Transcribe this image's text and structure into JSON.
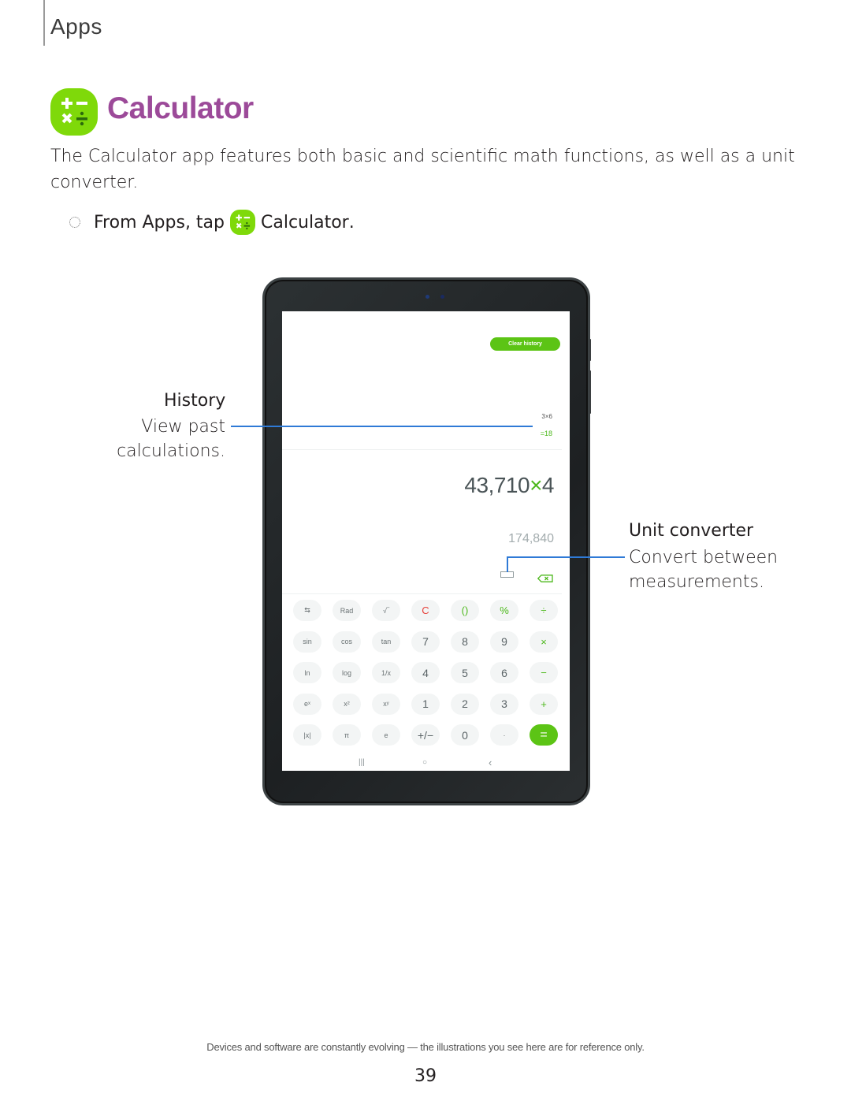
{
  "header": {
    "section": "Apps"
  },
  "title": {
    "text": "Calculator",
    "color": "#9c4a99",
    "icon": "calculator-app-icon",
    "icon_color": "#7fd90a"
  },
  "intro": "The Calculator app features both basic and scientific math functions, as well as a unit converter.",
  "step": {
    "prefix": "From Apps, tap",
    "app_name": "Calculator",
    "suffix": "."
  },
  "device_screen": {
    "clear_history_label": "Clear history",
    "history": {
      "expression": "3×6",
      "result": "=18"
    },
    "input": {
      "number": "43,710",
      "operator": "×",
      "operand": "4"
    },
    "preview_result": "174,840",
    "icons": {
      "unit_converter": "ruler-icon",
      "backspace": "backspace-icon"
    },
    "keypad": [
      [
        {
          "label": "⇆",
          "kind": "fn",
          "name": "switch-icon"
        },
        {
          "label": "Rad",
          "kind": "fn"
        },
        {
          "label": "√‾",
          "kind": "fn"
        },
        {
          "label": "C",
          "kind": "red"
        },
        {
          "label": "()",
          "kind": "green"
        },
        {
          "label": "%",
          "kind": "green"
        },
        {
          "label": "÷",
          "kind": "green"
        }
      ],
      [
        {
          "label": "sin",
          "kind": "fn"
        },
        {
          "label": "cos",
          "kind": "fn"
        },
        {
          "label": "tan",
          "kind": "fn"
        },
        {
          "label": "7",
          "kind": "num"
        },
        {
          "label": "8",
          "kind": "num"
        },
        {
          "label": "9",
          "kind": "num"
        },
        {
          "label": "×",
          "kind": "green"
        }
      ],
      [
        {
          "label": "ln",
          "kind": "fn"
        },
        {
          "label": "log",
          "kind": "fn"
        },
        {
          "label": "1/x",
          "kind": "fn"
        },
        {
          "label": "4",
          "kind": "num"
        },
        {
          "label": "5",
          "kind": "num"
        },
        {
          "label": "6",
          "kind": "num"
        },
        {
          "label": "−",
          "kind": "green"
        }
      ],
      [
        {
          "label": "eˣ",
          "kind": "fn"
        },
        {
          "label": "x²",
          "kind": "fn"
        },
        {
          "label": "xʸ",
          "kind": "fn"
        },
        {
          "label": "1",
          "kind": "num"
        },
        {
          "label": "2",
          "kind": "num"
        },
        {
          "label": "3",
          "kind": "num"
        },
        {
          "label": "+",
          "kind": "green"
        }
      ],
      [
        {
          "label": "|x|",
          "kind": "fn"
        },
        {
          "label": "π",
          "kind": "fn"
        },
        {
          "label": "e",
          "kind": "fn"
        },
        {
          "label": "+/−",
          "kind": "num"
        },
        {
          "label": "0",
          "kind": "num"
        },
        {
          "label": "·",
          "kind": "fn"
        },
        {
          "label": "=",
          "kind": "equals"
        }
      ]
    ],
    "nav": {
      "recents": "|||",
      "home": "○",
      "back": "‹"
    }
  },
  "callouts": {
    "history": {
      "title": "History",
      "text_line1": "View past",
      "text_line2": "calculations."
    },
    "unit_converter": {
      "title": "Unit converter",
      "text_line1": "Convert between",
      "text_line2": "measurements."
    },
    "leader_color": "#2f7ad6"
  },
  "footer": {
    "disclaimer": "Devices and software are constantly evolving — the illustrations you see here are for reference only.",
    "page_number": "39"
  }
}
